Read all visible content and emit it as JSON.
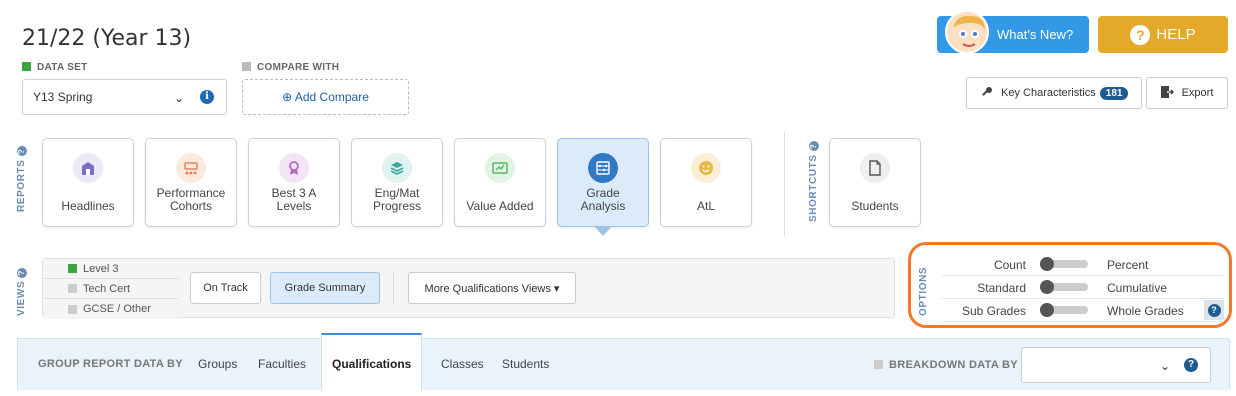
{
  "header": {
    "title": "21/22 (Year 13)"
  },
  "dataset": {
    "label": "DATA SET",
    "value": "Y13 Spring",
    "color": "#3fa33f"
  },
  "compare": {
    "label": "COMPARE WITH",
    "button": "⊕ Add Compare",
    "color": "#bbbbbb"
  },
  "top_buttons": {
    "whats_new": "What's New?",
    "help": "HELP"
  },
  "actions": {
    "key_characteristics": "Key Characteristics",
    "key_count": "181",
    "export": "Export"
  },
  "sections": {
    "reports": "REPORTS",
    "shortcuts": "SHORTCUTS",
    "views": "VIEWS",
    "options": "OPTIONS"
  },
  "reports": [
    {
      "line1": "",
      "line2": "Headlines",
      "color": "#7b6fc9",
      "bg": "#ece9f8"
    },
    {
      "line1": "Performance",
      "line2": "Cohorts",
      "color": "#e0875a",
      "bg": "#fbe9de"
    },
    {
      "line1": "Best 3 A",
      "line2": "Levels",
      "color": "#b06ec3",
      "bg": "#f3e4f7"
    },
    {
      "line1": "Eng/Mat",
      "line2": "Progress",
      "color": "#3aa6a0",
      "bg": "#dff3f1"
    },
    {
      "line1": "",
      "line2": "Value Added",
      "color": "#5bb56a",
      "bg": "#e2f3e4"
    },
    {
      "line1": "Grade",
      "line2": "Analysis",
      "color": "#3178c6",
      "bg": "#cfe1f5"
    },
    {
      "line1": "",
      "line2": "AtL",
      "color": "#e9b84a",
      "bg": "#fbf0d6"
    }
  ],
  "shortcuts": [
    {
      "label": "Students"
    }
  ],
  "views": {
    "levels": [
      {
        "label": "Level 3",
        "color": "#3fa33f"
      },
      {
        "label": "Tech Cert",
        "color": "#cccccc"
      },
      {
        "label": "GCSE / Other",
        "color": "#cccccc"
      }
    ],
    "buttons": [
      "On Track",
      "Grade Summary"
    ],
    "more": "More Qualifications Views ▾"
  },
  "options": [
    {
      "left": "Count",
      "right": "Percent"
    },
    {
      "left": "Standard",
      "right": "Cumulative"
    },
    {
      "left": "Sub Grades",
      "right": "Whole Grades"
    }
  ],
  "group_by": {
    "label": "GROUP REPORT DATA BY",
    "tabs": [
      "Groups",
      "Faculties",
      "Qualifications",
      "Classes",
      "Students"
    ],
    "active": "Qualifications",
    "breakdown_label": "BREAKDOWN DATA BY",
    "breakdown_value": ""
  }
}
